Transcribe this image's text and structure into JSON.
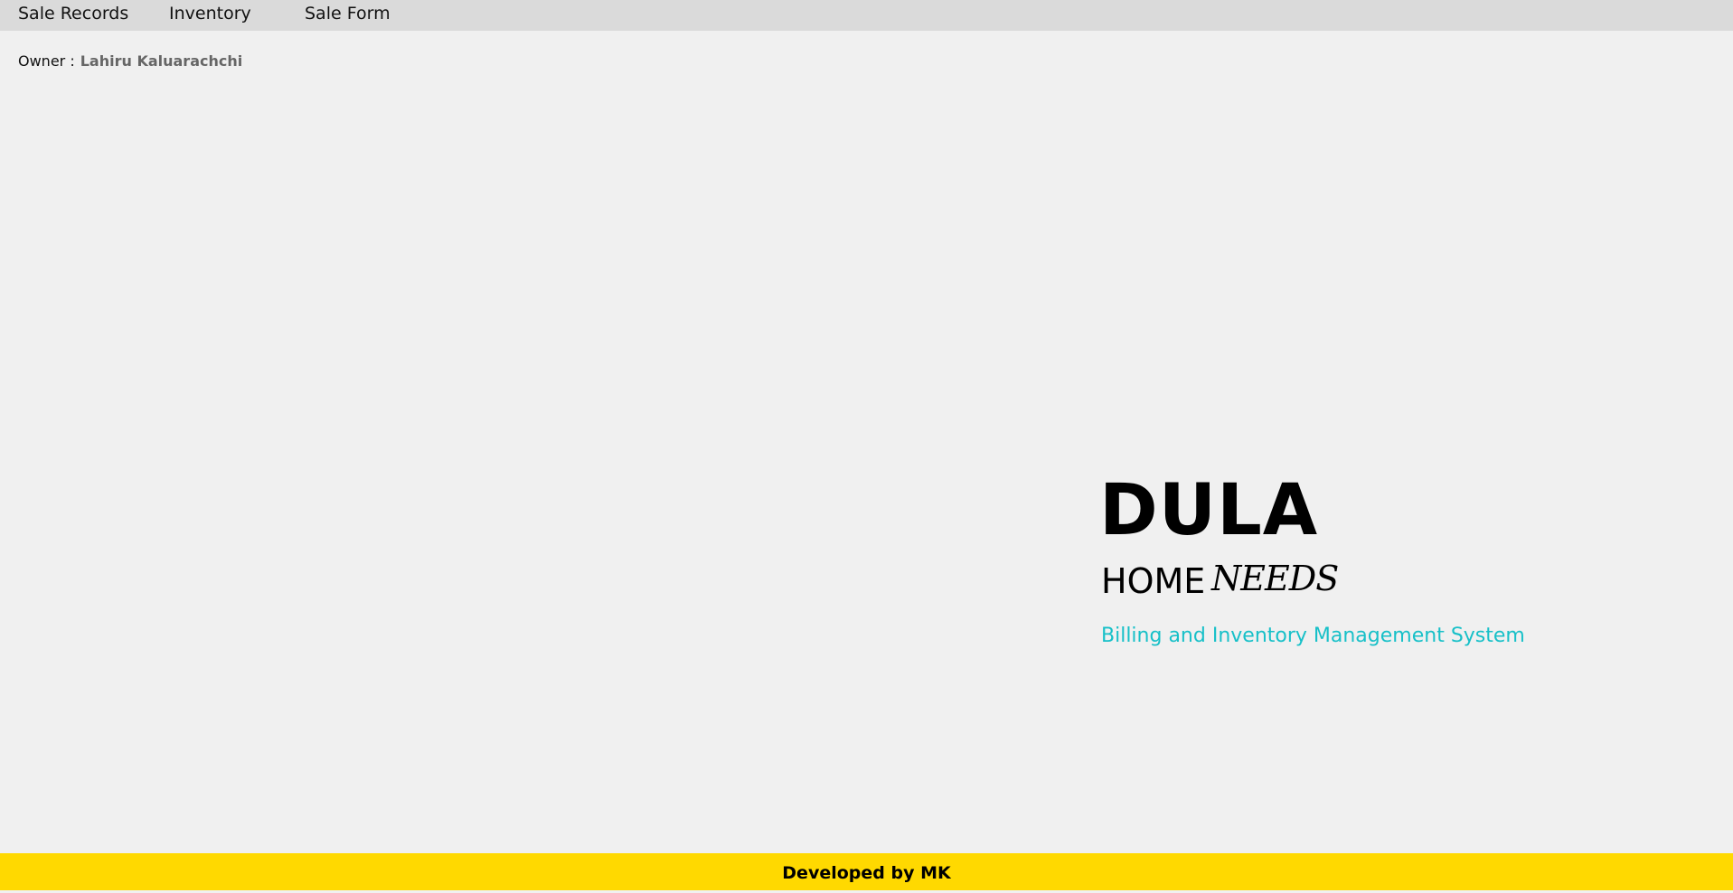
{
  "menu": {
    "items": [
      {
        "label": "Sale Records"
      },
      {
        "label": "Inventory"
      },
      {
        "label": "Sale Form"
      }
    ]
  },
  "owner": {
    "label": "Owner :",
    "name": "Lahiru Kaluarachchi"
  },
  "brand": {
    "title": "DULA",
    "home": "HOME",
    "needs": "NEEDS",
    "subtitle": "Billing and Inventory Management System"
  },
  "footer": {
    "text": "Developed by MK"
  },
  "colors": {
    "background": "#f0f0f0",
    "menubar": "#dadada",
    "subtitle_accent": "#17c0c8",
    "footer": "#ffd900"
  }
}
